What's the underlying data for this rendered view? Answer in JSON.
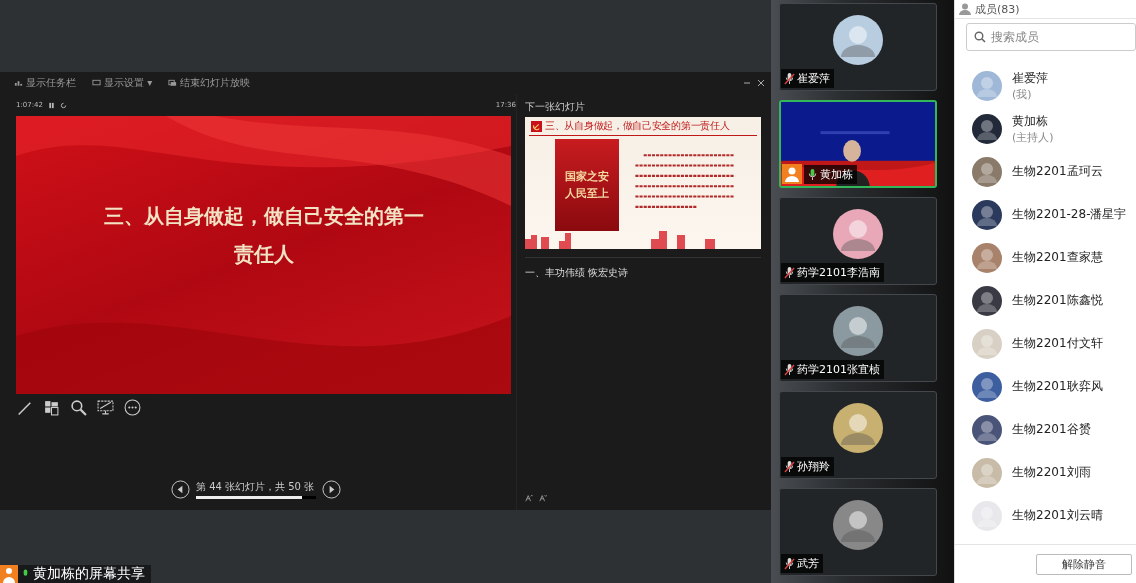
{
  "presenter": {
    "toolbar": [
      {
        "kind": "taskbar",
        "label": "显示任务栏"
      },
      {
        "kind": "display",
        "label": "显示设置 ▾"
      },
      {
        "kind": "end",
        "label": "结束幻灯片放映"
      }
    ],
    "timer": "1:07:42",
    "clock": "17:36",
    "slide": {
      "title": "三、从自身做起，做自己安全的第一责任人"
    },
    "next_label": "下一张幻灯片",
    "next_slide": {
      "heading": "三、从自身做起，做自己安全的第一责任人",
      "poster_title": "国家之安",
      "poster_subtitle": "人民至上"
    },
    "notes": "一、丰功伟绩 恢宏史诗",
    "nav": {
      "text": "第 44 张幻灯片，共 50 张",
      "level": 0.88
    }
  },
  "share_label": "黄加栋的屏幕共享",
  "tiles": [
    {
      "name": "崔爱萍",
      "kind": "avatar",
      "muted": true,
      "active": false
    },
    {
      "name": "黄加栋",
      "kind": "video",
      "muted": false,
      "active": true
    },
    {
      "name": "药学2101李浩南",
      "kind": "avatar",
      "muted": true,
      "active": false
    },
    {
      "name": "药学2101张宜桢",
      "kind": "avatar",
      "muted": true,
      "active": false
    },
    {
      "name": "孙翔羚",
      "kind": "avatar",
      "muted": true,
      "active": false
    },
    {
      "name": "武芳",
      "kind": "avatar",
      "muted": true,
      "active": false
    }
  ],
  "members": {
    "title": "成员(83)",
    "search": {
      "placeholder": "搜索成员"
    },
    "items": [
      {
        "name": "崔爱萍",
        "role": "(我)"
      },
      {
        "name": "黄加栋",
        "role": "(主持人)"
      },
      {
        "name": "生物2201孟珂云"
      },
      {
        "name": "生物2201-28-潘星宇"
      },
      {
        "name": "生物2201查家慧"
      },
      {
        "name": "生物2201陈鑫悦"
      },
      {
        "name": "生物2201付文轩"
      },
      {
        "name": "生物2201耿弈风"
      },
      {
        "name": "生物2201谷赟"
      },
      {
        "name": "生物2201刘雨"
      },
      {
        "name": "生物2201刘云晴"
      }
    ],
    "unmute_button": "解除静音"
  }
}
